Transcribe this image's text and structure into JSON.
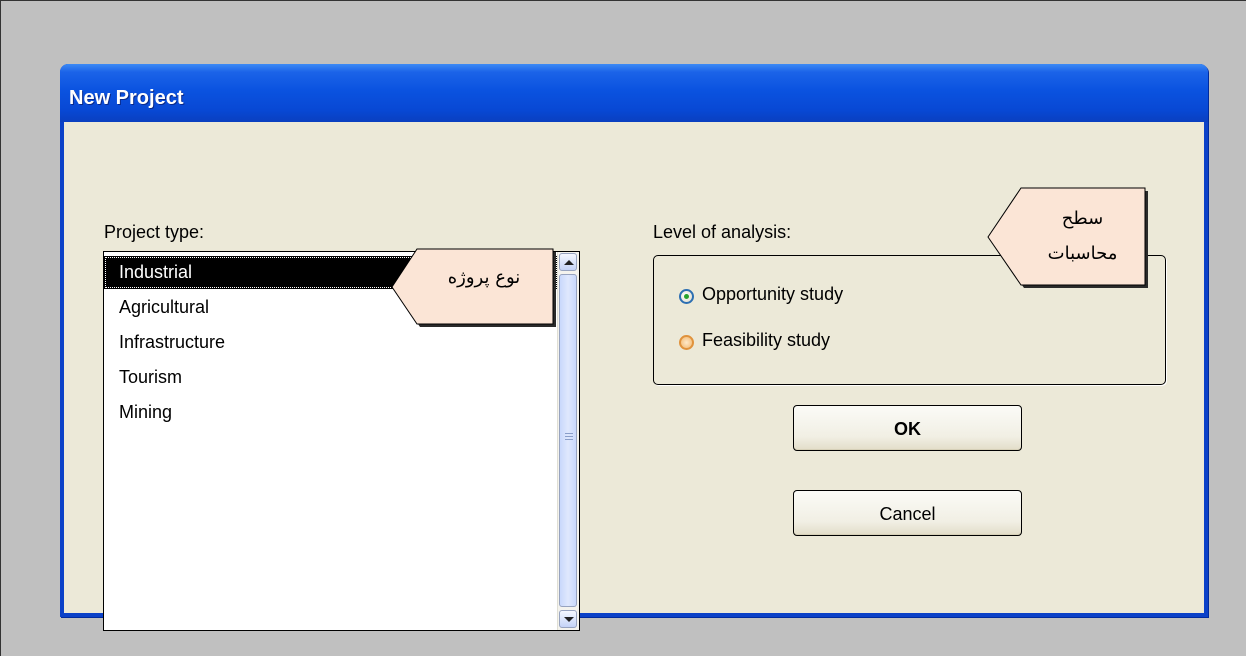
{
  "dialog": {
    "title": "New Project",
    "project_type_label": "Project type:",
    "project_types": [
      "Industrial",
      "Agricultural",
      "Infrastructure",
      "Tourism",
      "Mining"
    ],
    "selected_project_type": "Industrial",
    "level_label": "Level of analysis:",
    "levels": [
      "Opportunity study",
      "Feasibility study"
    ],
    "selected_level": "Opportunity study",
    "ok_label": "OK",
    "cancel_label": "Cancel"
  },
  "callouts": {
    "project_type_note": "نوع پروژه",
    "level_note_line1": "سطح",
    "level_note_line2": "محاسبات"
  },
  "colors": {
    "titlebar": "#0b53e0",
    "client_bg": "#ece9d8",
    "selection": "#000000",
    "callout_bg": "#fbe5d6",
    "radio_selected_dot": "#27a32d",
    "radio_unselected": "#f1b66c"
  },
  "icons": {
    "scroll_up": "triangle-up-icon",
    "scroll_down": "triangle-down-icon",
    "thumb_grip": "grip-icon"
  }
}
